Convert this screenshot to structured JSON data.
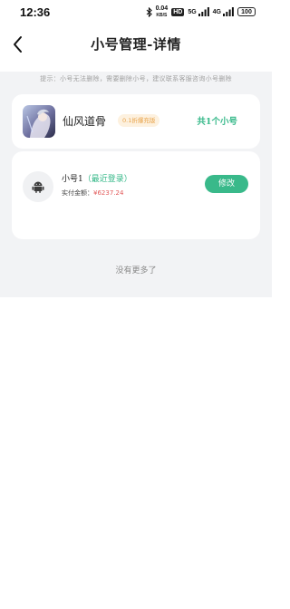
{
  "status_bar": {
    "time": "12:36",
    "net_speed_value": "0.04",
    "net_speed_unit": "KB/S",
    "hd_label": "HD",
    "signal1_label": "5G",
    "signal2_label": "4G",
    "battery_level": "100"
  },
  "nav": {
    "title": "小号管理-详情"
  },
  "hint": "提示：小号无法删除，需要删除小号，建议联系客服咨询小号删除",
  "game": {
    "name": "仙风道骨",
    "tag": "0.1折爆充版",
    "account_count": "共1个小号"
  },
  "account": {
    "name": "小号1",
    "status": "（最近登录）",
    "spend_label": "实付金额：",
    "spend_value": "¥6237.24",
    "edit_label": "修改"
  },
  "footer": {
    "no_more": "没有更多了"
  },
  "colors": {
    "accent": "#39b98a",
    "price": "#e25a5a",
    "tag_bg": "#fdf1df",
    "tag_text": "#e8a34a",
    "page_bg": "#f2f3f5"
  }
}
